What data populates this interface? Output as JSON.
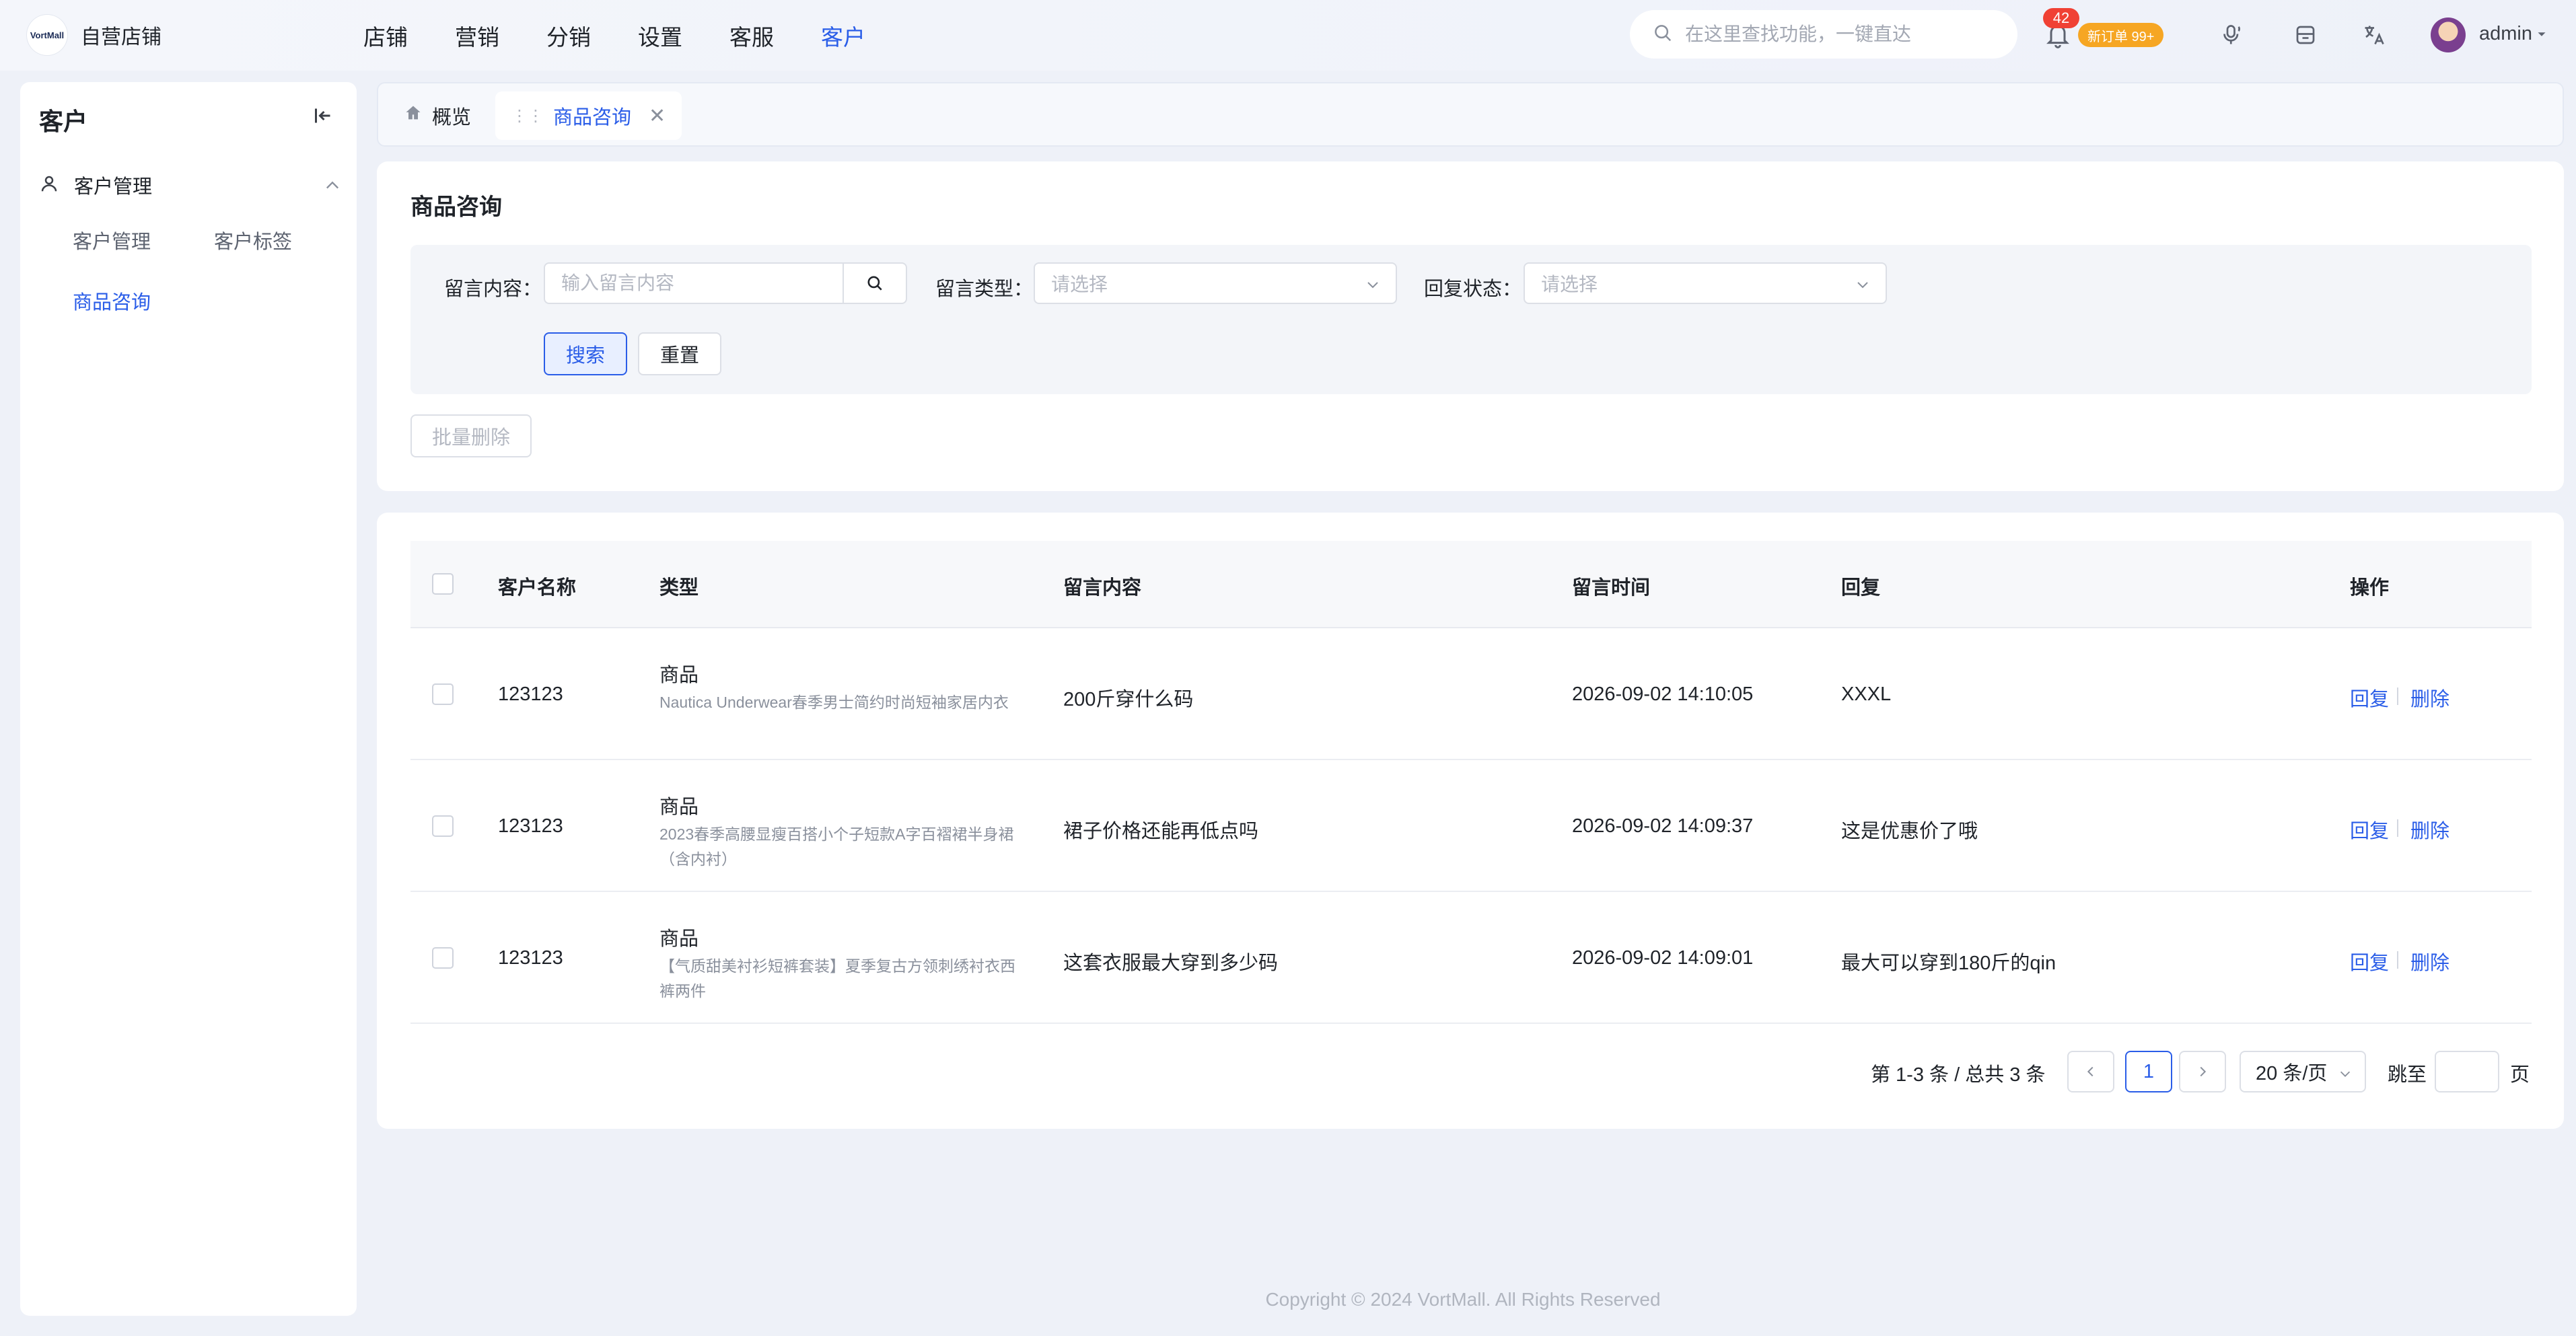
{
  "brand": {
    "logo_text": "VortMall",
    "store_name": "自营店铺"
  },
  "main_nav": [
    {
      "label": "店铺"
    },
    {
      "label": "营销"
    },
    {
      "label": "分销"
    },
    {
      "label": "设置"
    },
    {
      "label": "客服"
    },
    {
      "label": "客户",
      "active": true
    }
  ],
  "header": {
    "search_placeholder": "在这里查找功能，一键直达",
    "notification_count": "42",
    "new_order_badge": "新订单 99+",
    "user_name": "admin"
  },
  "sidebar": {
    "title": "客户",
    "group_label": "客户管理",
    "items": [
      {
        "label": "客户管理"
      },
      {
        "label": "客户标签"
      },
      {
        "label": "商品咨询",
        "active": true
      }
    ]
  },
  "tabs": [
    {
      "label": "概览",
      "icon": "home-icon"
    },
    {
      "label": "商品咨询",
      "active": true
    }
  ],
  "filter": {
    "heading": "商品咨询",
    "content_label": "留言内容：",
    "content_placeholder": "输入留言内容",
    "type_label": "留言类型：",
    "type_placeholder": "请选择",
    "status_label": "回复状态：",
    "status_placeholder": "请选择",
    "search_button": "搜索",
    "reset_button": "重置",
    "batch_delete_button": "批量删除"
  },
  "table": {
    "columns": [
      "客户名称",
      "类型",
      "留言内容",
      "留言时间",
      "回复",
      "操作"
    ],
    "rows": [
      {
        "customer": "123123",
        "type": "商品",
        "product": "Nautica Underwear春季男士简约时尚短袖家居内衣",
        "content": "200斤穿什么码",
        "time": "2026-09-02 14:10:05",
        "reply": "XXXL"
      },
      {
        "customer": "123123",
        "type": "商品",
        "product": "2023春季高腰显瘦百搭小个子短款A字百褶裙半身裙（含内衬）",
        "content": "裙子价格还能再低点吗",
        "time": "2026-09-02 14:09:37",
        "reply": "这是优惠价了哦"
      },
      {
        "customer": "123123",
        "type": "商品",
        "product": "【气质甜美衬衫短裤套装】夏季复古方领刺绣衬衣西裤两件",
        "content": "这套衣服最大穿到多少码",
        "time": "2026-09-02 14:09:01",
        "reply": "最大可以穿到180斤的qin"
      }
    ],
    "action_reply": "回复",
    "action_delete": "删除"
  },
  "pagination": {
    "summary": "第 1-3 条 / 总共 3 条",
    "current_page": "1",
    "page_size": "20 条/页",
    "jump_label": "跳至",
    "page_suffix": "页"
  },
  "footer": {
    "copyright": "Copyright © 2024 VortMall. All Rights Reserved"
  },
  "colors": {
    "accent": "#2a5de8",
    "badge_red": "#f04134",
    "badge_orange": "#f6a623"
  }
}
